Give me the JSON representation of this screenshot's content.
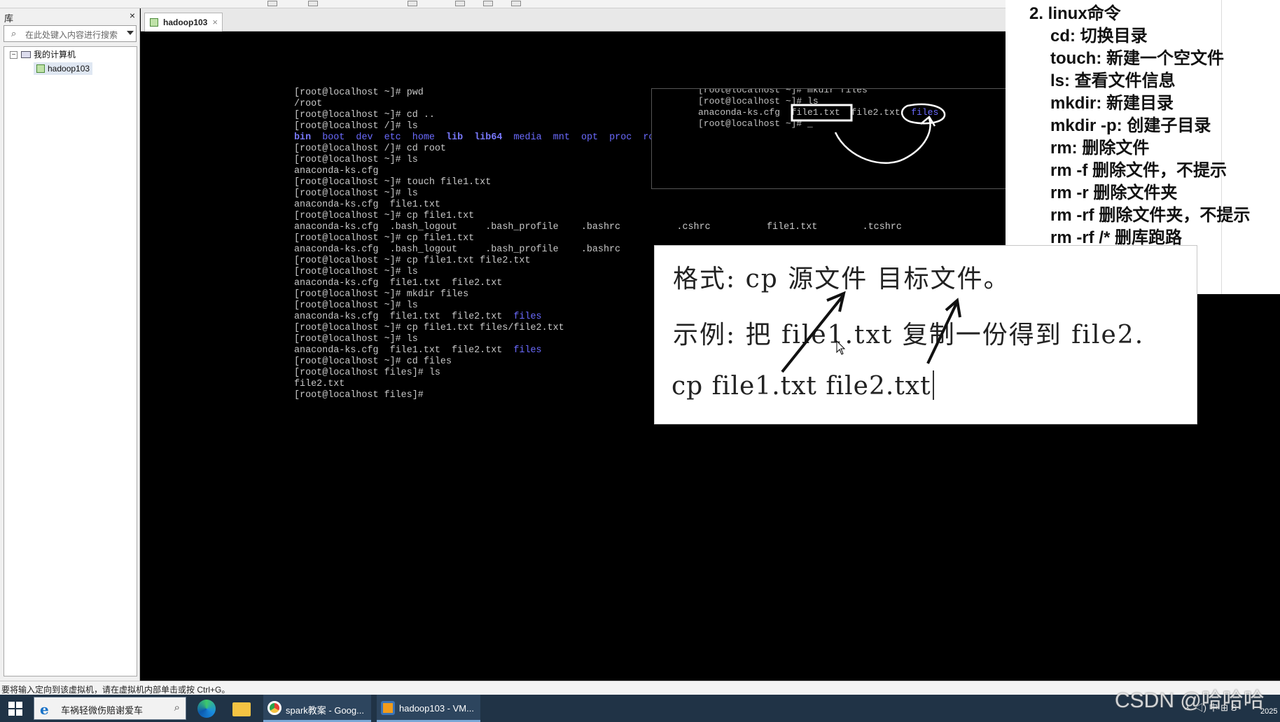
{
  "library": {
    "title": "库",
    "close": "×",
    "search_placeholder": "在此处键入内容进行搜索",
    "tree": {
      "expander": "−",
      "root": "我的计算机",
      "vm": "hadoop103"
    }
  },
  "vm_tab": {
    "label": "hadoop103",
    "close": "×"
  },
  "terminal": {
    "lines": [
      "[root@localhost ~]# pwd",
      "/root",
      "[root@localhost ~]# cd ..",
      "[root@localhost /]# ls",
      "__LSROOT__",
      "[root@localhost /]# cd root",
      "[root@localhost ~]# ls",
      "anaconda-ks.cfg",
      "[root@localhost ~]# touch file1.txt",
      "[root@localhost ~]# ls",
      "anaconda-ks.cfg  file1.txt",
      "[root@localhost ~]# cp file1.txt",
      "anaconda-ks.cfg  .bash_logout     .bash_profile    .bashrc          .cshrc          file1.txt        .tcshrc",
      "[root@localhost ~]# cp file1.txt",
      "anaconda-ks.cfg  .bash_logout     .bash_profile    .bashrc",
      "[root@localhost ~]# cp file1.txt file2.txt",
      "[root@localhost ~]# ls",
      "anaconda-ks.cfg  file1.txt  file2.txt",
      "[root@localhost ~]# mkdir files",
      "[root@localhost ~]# ls",
      "__LSFILES1__",
      "[root@localhost ~]# cp file1.txt files/file2.txt",
      "[root@localhost ~]# ls",
      "__LSFILES2__",
      "[root@localhost ~]# cd files",
      "[root@localhost files]# ls",
      "file2.txt",
      "[root@localhost files]#"
    ],
    "ls_root_dirs": [
      "bin",
      "boot",
      "dev",
      "etc",
      "home",
      "lib",
      "lib64",
      "media",
      "mnt",
      "opt",
      "proc",
      "ro"
    ],
    "ls_files_text": "anaconda-ks.cfg  file1.txt  file2.txt  ",
    "ls_files_dir": "files"
  },
  "mini_terminal": {
    "lines": [
      "[root@localhost ~]# mkdir files",
      "[root@localhost ~]# ls",
      "anaconda-ks.cfg  file1.txt  file2.txt  ",
      "[root@localhost ~]# _"
    ],
    "dir": "files"
  },
  "notes": {
    "title": "2. linux命令",
    "items": [
      "cd:   切换目录",
      "touch: 新建一个空文件",
      "ls: 查看文件信息",
      "mkdir: 新建目录",
      "mkdir -p: 创建子目录",
      "rm: 删除文件",
      "rm -f 删除文件，不提示",
      "rm -r 删除文件夹",
      "rm -rf 删除文件夹，不提示",
      "rm -rf /* 删库跑路"
    ]
  },
  "card": {
    "format": "格式:  cp 源文件 目标文件。",
    "example": "示例:  把 file1.txt 复制一份得到 file2.",
    "command": "cp file1.txt file2.txt"
  },
  "status_bar": {
    "text": "要将输入定向到该虚拟机，请在虚拟机内部单击或按 Ctrl+G。"
  },
  "taskbar": {
    "search_text": "车祸轻微伤赔谢爱车",
    "apps": [
      {
        "label": "spark教案 - Goog..."
      },
      {
        "label": "hadoop103 - VM..."
      }
    ],
    "tray": "ㅅ  ◁)  中  ⊞  S",
    "year": "2025"
  },
  "watermark": "CSDN @哈哈哈",
  "colors": {
    "console_bg": "#000000",
    "dir_blue": "#6b6bff",
    "taskbar_bg": "#203346"
  }
}
